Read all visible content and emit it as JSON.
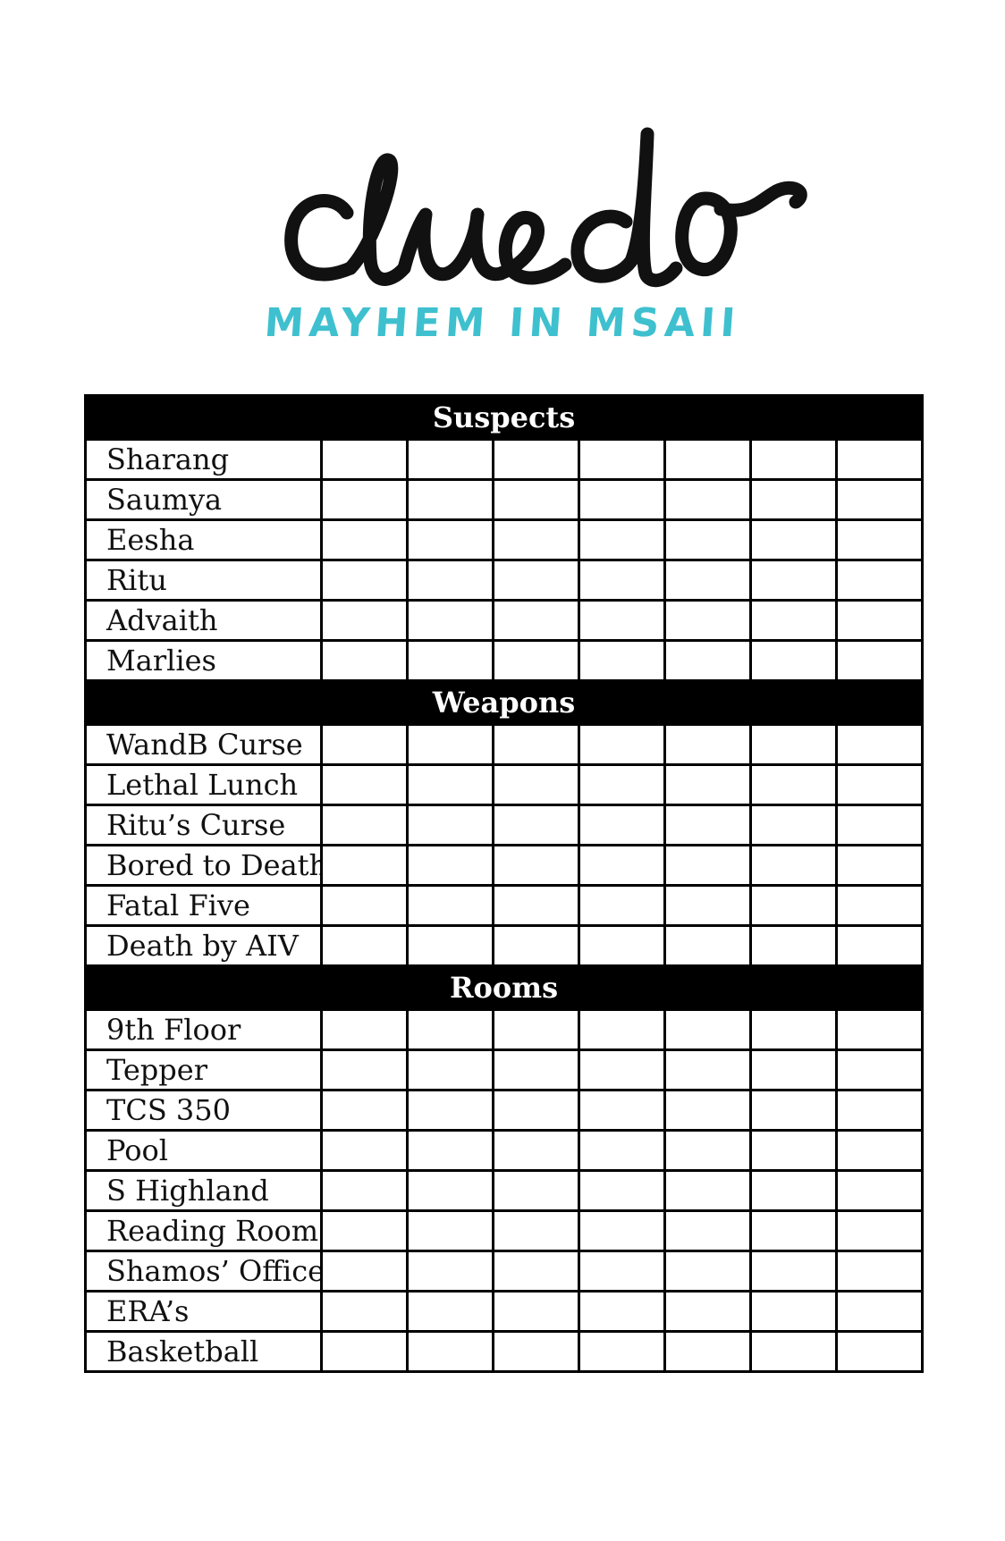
{
  "logo": {
    "wordmark": "cluedo",
    "subtitle": "MAYHEM IN MSAII",
    "subtitle_color": "#3fc0cf"
  },
  "sheet": {
    "mark_columns": 7,
    "sections": [
      {
        "title": "Suspects",
        "items": [
          "Sharang",
          "Saumya",
          "Eesha",
          "Ritu",
          "Advaith",
          "Marlies"
        ]
      },
      {
        "title": "Weapons",
        "items": [
          "WandB Curse",
          "Lethal Lunch",
          "Ritu’s Curse",
          "Bored to Death",
          "Fatal Five",
          "Death by AIV"
        ]
      },
      {
        "title": "Rooms",
        "items": [
          "9th Floor",
          "Tepper",
          "TCS 350",
          "Pool",
          "S Highland",
          "Reading Room",
          "Shamos’ Office",
          "ERA’s",
          "Basketball"
        ]
      }
    ]
  }
}
